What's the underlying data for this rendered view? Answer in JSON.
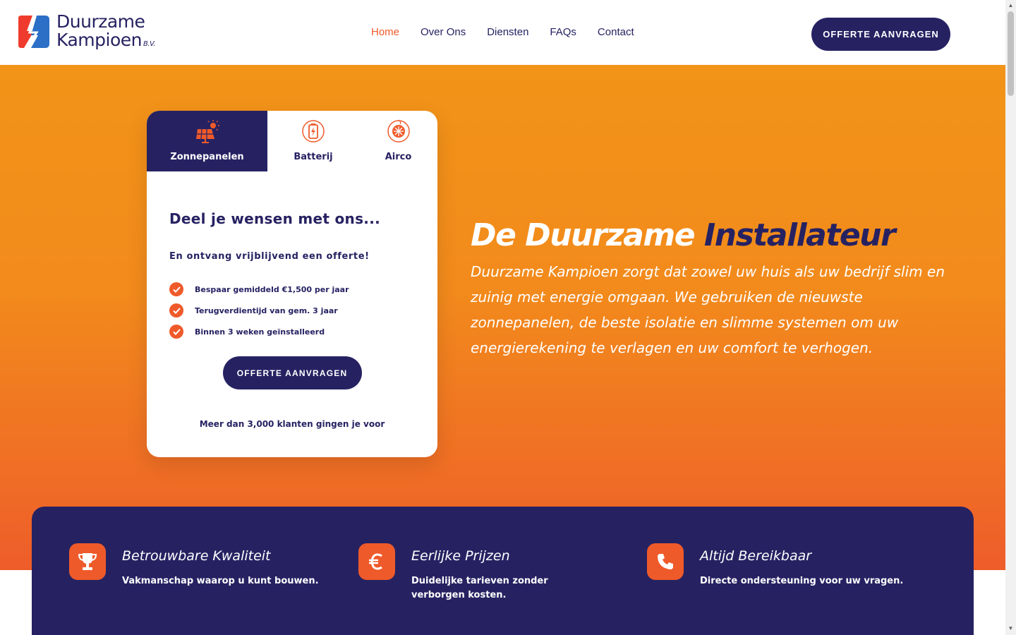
{
  "brand": {
    "name_line1": "Duurzame",
    "name_line2": "Kampioen",
    "suffix": "B.V."
  },
  "nav": {
    "items": [
      {
        "label": "Home",
        "active": true
      },
      {
        "label": "Over Ons"
      },
      {
        "label": "Diensten"
      },
      {
        "label": "FAQs"
      },
      {
        "label": "Contact"
      }
    ],
    "cta": "OFFERTE AANVRAGEN"
  },
  "card": {
    "tabs": [
      {
        "label": "Zonnepanelen",
        "icon": "solar-panel-icon"
      },
      {
        "label": "Batterij",
        "icon": "battery-icon"
      },
      {
        "label": "Airco",
        "icon": "airco-icon"
      }
    ],
    "heading": "Deel je wensen met ons...",
    "subheading": "En ontvang vrijblijvend een offerte!",
    "checks": [
      "Bespaar gemiddeld €1,500 per jaar",
      "Terugverdientijd van gem. 3 jaar",
      "Binnen 3 weken geïnstalleerd"
    ],
    "cta": "OFFERTE AANVRAGEN",
    "footnote": "Meer dan 3,000 klanten gingen je voor"
  },
  "hero": {
    "title_white": "De Duurzame",
    "title_dark": "Installateur",
    "description": "Duurzame Kampioen zorgt dat zowel uw huis als uw bedrijf slim en zuinig met energie omgaan. We gebruiken de nieuwste zonnepanelen, de beste isolatie en slimme systemen om uw energierekening te verlagen en uw comfort te verhogen."
  },
  "features": [
    {
      "title": "Betrouwbare Kwaliteit",
      "desc": "Vakmanschap waarop u kunt bouwen.",
      "icon": "trophy-icon"
    },
    {
      "title": "Eerlijke Prijzen",
      "desc": "Duidelijke tarieven zonder verborgen kosten.",
      "icon": "euro-icon"
    },
    {
      "title": "Altijd Bereikbaar",
      "desc": "Directe ondersteuning voor uw vragen.",
      "icon": "phone-icon"
    }
  ],
  "colors": {
    "brand_dark": "#262262",
    "brand_orange": "#ef5a2a",
    "hero_orange": "#f29418"
  }
}
